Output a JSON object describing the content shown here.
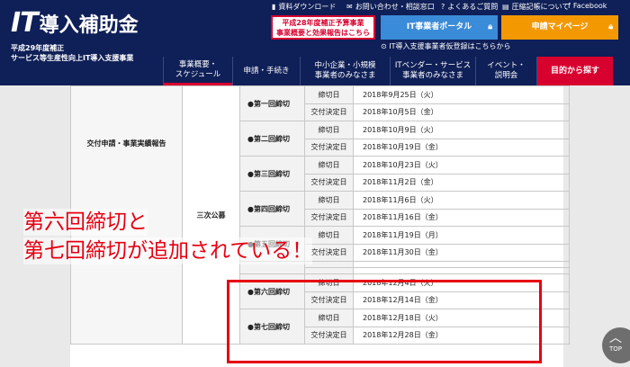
{
  "brand": {
    "logo_it": "IT",
    "logo_jp": "導入補助金",
    "sub1": "平成29年度補正",
    "sub2": "サービス等生産性向上IT導入支援事業"
  },
  "util": {
    "docs": "資料ダウンロード",
    "contact": "お問い合わせ・相談窓口",
    "faq": "よくあるご質問",
    "sitemap": "圧縮記帳について",
    "facebook": "Facebook"
  },
  "notice": {
    "line1": "平成28年度補正予算事業",
    "line2": "事業概要と効果報告はこちら"
  },
  "buttons": {
    "portal": "IT事業者ポータル",
    "mypage": "申請マイページ"
  },
  "search_line": "IT導入支援事業者仮登録はこちらから",
  "nav": [
    {
      "label1": "事業概要・",
      "label2": "スケジュール"
    },
    {
      "label1": "申請・手続き",
      "label2": ""
    },
    {
      "label1": "中小企業・小規模",
      "label2": "事業者のみなさま"
    },
    {
      "label1": "ITベンダー・サービス",
      "label2": "事業者のみなさま"
    },
    {
      "label1": "イベント・",
      "label2": "説明会"
    },
    {
      "label1": "目的から探す",
      "label2": ""
    }
  ],
  "table": {
    "category": "交付申請・事業実績報告",
    "koubo": "三次公募",
    "deadline_label": "締切日",
    "decision_label": "交付決定日",
    "rounds": [
      {
        "name": "●第一回締切",
        "deadline": "2018年9月25日（火）",
        "decision": "2018年10月5日（金）"
      },
      {
        "name": "●第二回締切",
        "deadline": "2018年10月9日（火）",
        "decision": "2018年10月19日（金）"
      },
      {
        "name": "●第三回締切",
        "deadline": "2018年10月23日（火）",
        "decision": "2018年11月2日（金）"
      },
      {
        "name": "●第四回締切",
        "deadline": "2018年11月6日（火）",
        "decision": "2018年11月16日（金）"
      },
      {
        "name": "●第五回締切",
        "deadline": "2018年11月19日（月）",
        "decision": "2018年11月30日（金）"
      },
      {
        "name": "●第六回締切",
        "deadline": "2018年12月4日（火）",
        "decision": "2018年12月14日（金）"
      },
      {
        "name": "●第七回締切",
        "deadline": "2018年12月18日（火）",
        "decision": "2018年12月28日（金）"
      }
    ]
  },
  "annotation": {
    "line1": "第六回締切と",
    "line2": "第七回締切が追加されている！"
  },
  "top_button": "TOP",
  "colors": {
    "navy": "#0f1f57",
    "red": "#e60012",
    "portal_blue": "#3a8bd8",
    "orange": "#f39800"
  }
}
